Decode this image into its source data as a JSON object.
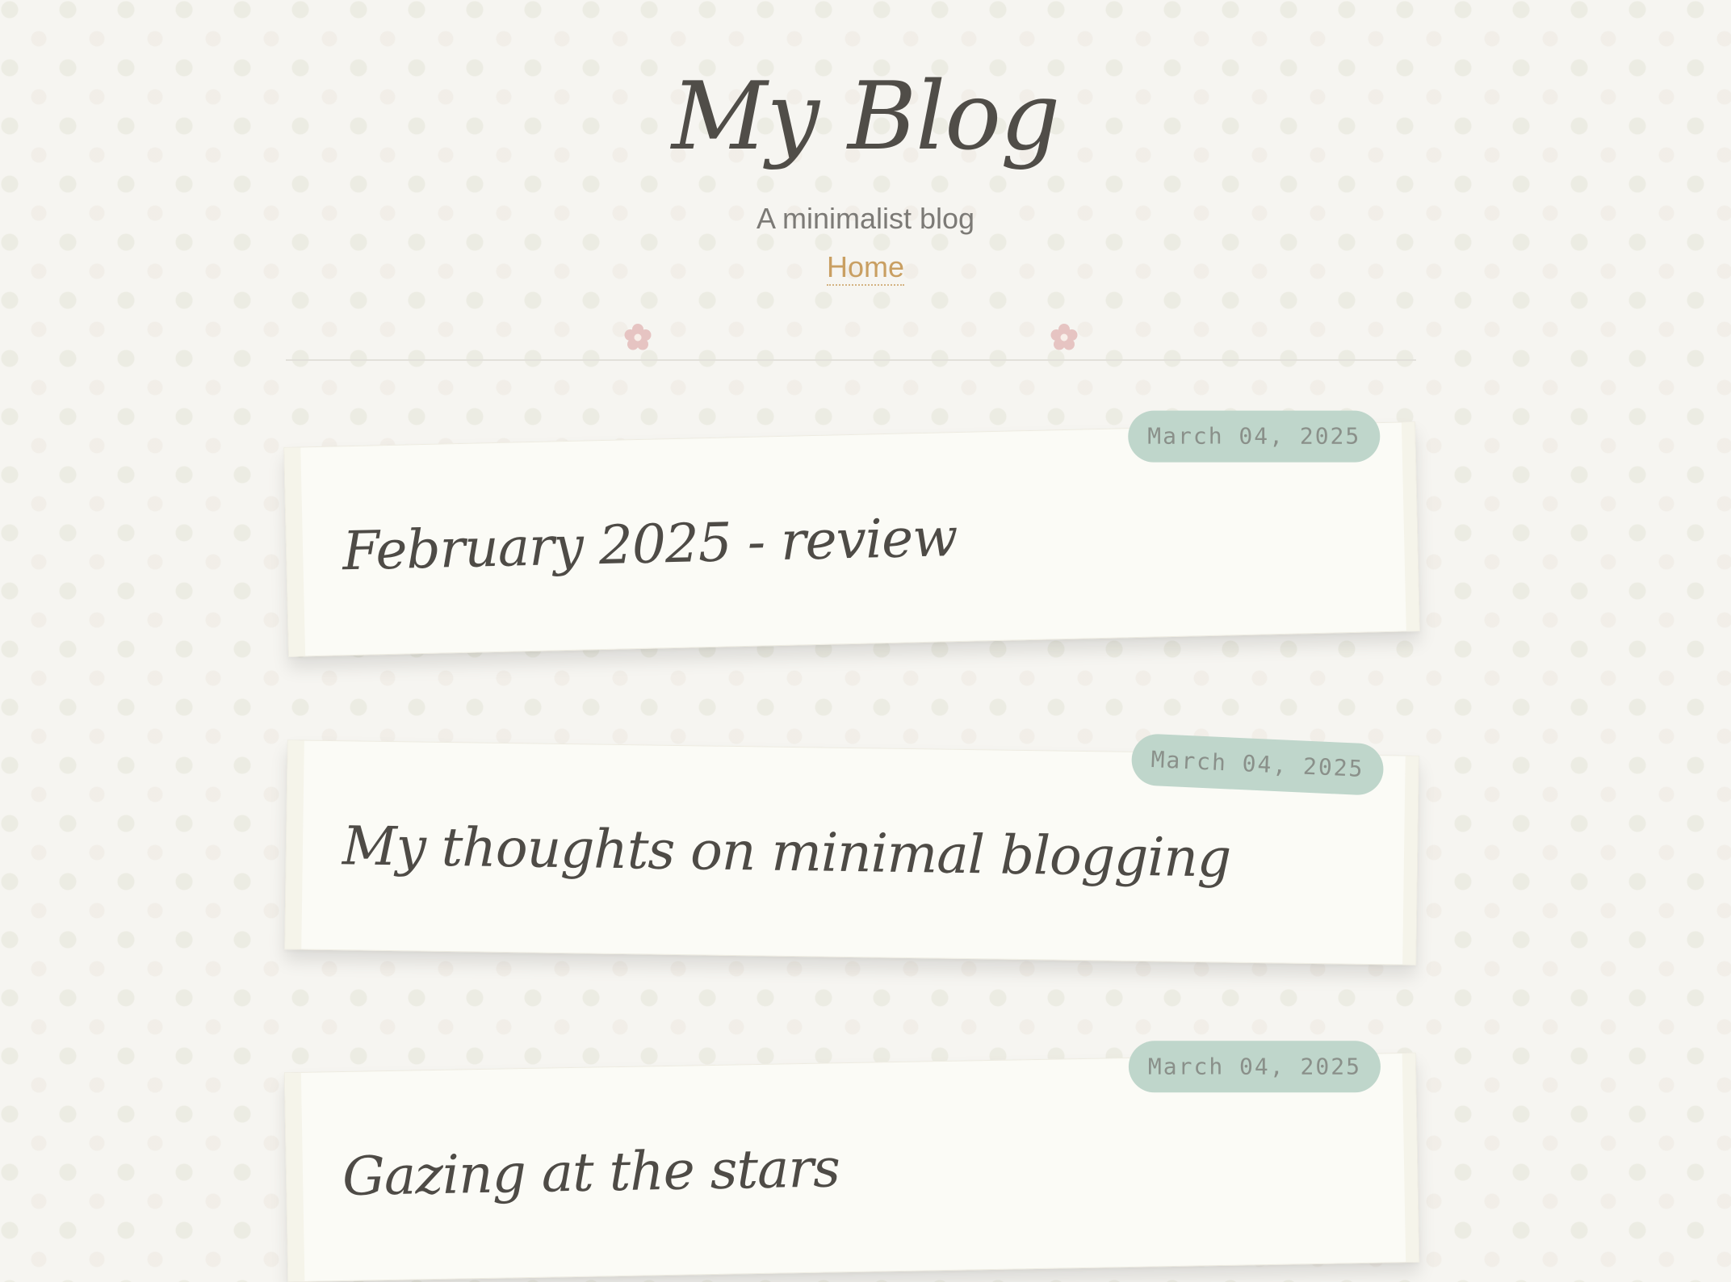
{
  "site": {
    "title": "My Blog",
    "tagline": "A minimalist blog"
  },
  "nav": {
    "home_label": "Home"
  },
  "decor": {
    "divider_icon": "flower-icon"
  },
  "posts": [
    {
      "title": "February 2025 - review",
      "date": "March 04, 2025"
    },
    {
      "title": "My thoughts on minimal blogging",
      "date": "March 04, 2025"
    },
    {
      "title": "Gazing at the stars",
      "date": "March 04, 2025"
    }
  ],
  "colors": {
    "background": "#f6f5f1",
    "card": "#fbfbf6",
    "title_text": "#504d48",
    "link": "#c99f62",
    "badge": "#bfd6cb",
    "flower": "#e6c4c2"
  }
}
